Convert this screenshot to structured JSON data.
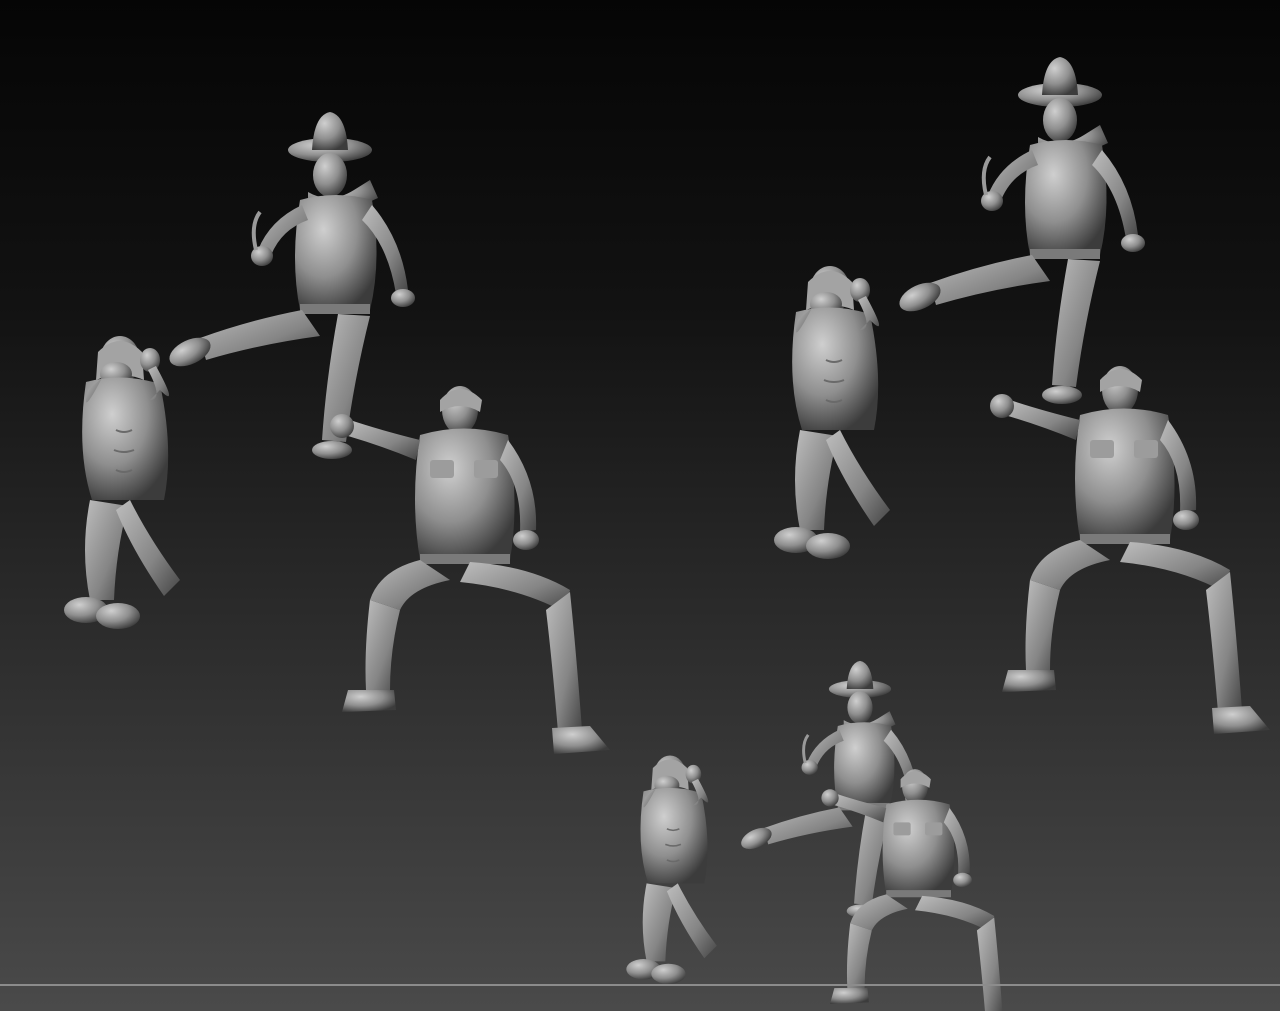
{
  "scene": {
    "background_top": "#050505",
    "background_bottom": "#4a4a4a",
    "figure_color": "#8f8f8f",
    "figure_highlight": "#c4c4c4",
    "figure_shadow": "#3a3a3a",
    "groups": [
      {
        "name": "group-left",
        "figures": [
          "hat-figure-kicking",
          "bandana-figure-covering-face",
          "sitting-soldier-laughing"
        ]
      },
      {
        "name": "group-right",
        "figures": [
          "hat-figure-kicking",
          "bandana-figure-covering-face",
          "sitting-soldier-laughing"
        ]
      },
      {
        "name": "group-bottom",
        "figures": [
          "hat-figure-kicking",
          "bandana-figure-covering-face",
          "sitting-soldier-laughing"
        ]
      }
    ]
  }
}
